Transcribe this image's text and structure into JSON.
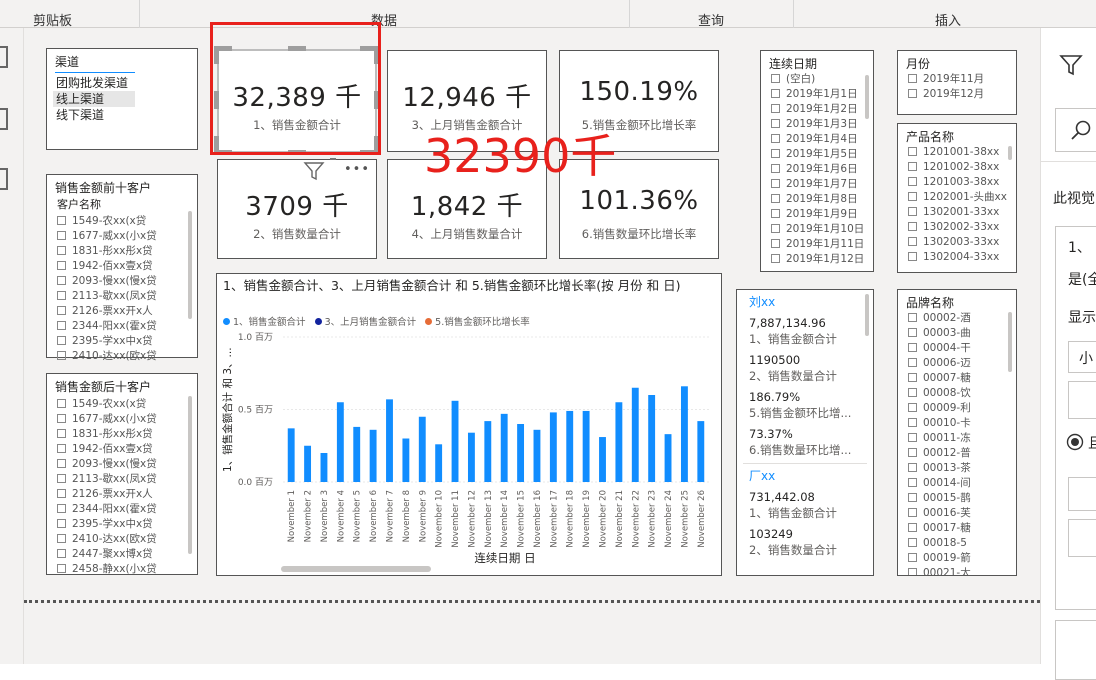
{
  "ribbon": {
    "groups": [
      "剪贴板",
      "数据",
      "查询",
      "插入"
    ]
  },
  "channel_slicer": {
    "title": "渠道",
    "items": [
      "团购批发渠道",
      "线上渠道",
      "线下渠道"
    ]
  },
  "cards": [
    {
      "value": "32,389 千",
      "label": "1、销售金额合计"
    },
    {
      "value": "12,946 千",
      "label": "3、上月销售金额合计"
    },
    {
      "value": "150.19%",
      "label": "5.销售金额环比增长率"
    },
    {
      "value": "3709 千",
      "label": "2、销售数量合计"
    },
    {
      "value": "1,842 千",
      "label": "4、上月销售数量合计"
    },
    {
      "value": "101.36%",
      "label": "6.销售数量环比增长率"
    }
  ],
  "annotation": "32390千",
  "top10": {
    "title": "销售金额前十客户",
    "header": "客户名称",
    "items": [
      "1549-农xx(x贷",
      "1677-威xx(小x贷",
      "1831-彤xx彤x贷",
      "1942-佰xx壹x贷",
      "2093-慢xx(慢x贷",
      "2113-歇xx(凤x贷",
      "2126-票xx开x人",
      "2344-阳xx(霍x贷",
      "2395-学xx中x贷",
      "2410-达xx(欧x贷"
    ]
  },
  "bottom10": {
    "title": "销售金额后十客户",
    "items": [
      "1549-农xx(x贷",
      "1677-威xx(小x贷",
      "1831-彤xx彤x贷",
      "1942-佰xx壹x贷",
      "2093-慢xx(慢x贷",
      "2113-歇xx(凤x贷",
      "2126-票xx开x人",
      "2344-阳xx(霍x贷",
      "2395-学xx中x贷",
      "2410-达xx(欧x贷",
      "2447-聚xx博x贷",
      "2458-静xx(小x贷"
    ]
  },
  "date_slicer": {
    "title": "连续日期",
    "items": [
      "(空白)",
      "2019年1月1日",
      "2019年1月2日",
      "2019年1月3日",
      "2019年1月4日",
      "2019年1月5日",
      "2019年1月6日",
      "2019年1月7日",
      "2019年1月8日",
      "2019年1月9日",
      "2019年1月10日",
      "2019年1月11日",
      "2019年1月12日"
    ]
  },
  "month_slicer": {
    "title": "月份",
    "items": [
      "2019年11月",
      "2019年12月"
    ]
  },
  "product_slicer": {
    "title": "产品名称",
    "items": [
      "1201001-38xx",
      "1201002-38xx",
      "1201003-38xx",
      "1202001-头曲xx",
      "1302001-33xx",
      "1302002-33xx",
      "1302003-33xx",
      "1302004-33xx"
    ]
  },
  "brand_slicer": {
    "title": "品牌名称",
    "items": [
      "00002-酒",
      "00003-曲",
      "00004-干",
      "00006-迈",
      "00007-糖",
      "00008-饮",
      "00009-利",
      "00010-卡",
      "00011-冻",
      "00012-普",
      "00013-茶",
      "00014-间",
      "00015-鹊",
      "00016-芙",
      "00017-糖",
      "00018-5",
      "00019-箭",
      "00021-太"
    ]
  },
  "multirow": [
    {
      "name": "刘xx",
      "rows": [
        {
          "v": "7,887,134.96",
          "k": "1、销售金额合计"
        },
        {
          "v": "1190500",
          "k": "2、销售数量合计"
        },
        {
          "v": "186.79%",
          "k": "5.销售金额环比增..."
        },
        {
          "v": "73.37%",
          "k": "6.销售数量环比增..."
        }
      ]
    },
    {
      "name": "厂xx",
      "rows": [
        {
          "v": "731,442.08",
          "k": "1、销售金额合计"
        },
        {
          "v": "103249",
          "k": "2、销售数量合计"
        }
      ]
    }
  ],
  "colors": {
    "series1": "#118dff",
    "series2": "#12239e",
    "series3": "#e66c37",
    "annotation": "#e8211c"
  },
  "chart_data": {
    "type": "bar",
    "title": "1、销售金额合计、3、上月销售金额合计 和 5.销售金额环比增长率(按 月份 和 日)",
    "xlabel": "连续日期 日",
    "ylabel": "1、销售金额合计 和 3、...",
    "legend": [
      "1、销售金额合计",
      "3、上月销售金额合计",
      "5.销售金额环比增长率"
    ],
    "ylim": [
      0,
      1.0
    ],
    "yticks": [
      "0.0 百万",
      "0.5 百万",
      "1.0 百万"
    ],
    "categories": [
      "November 1",
      "November 2",
      "November 3",
      "November 4",
      "November 5",
      "November 6",
      "November 7",
      "November 8",
      "November 9",
      "November 10",
      "November 11",
      "November 12",
      "November 13",
      "November 14",
      "November 15",
      "November 16",
      "November 17",
      "November 18",
      "November 19",
      "November 20",
      "November 21",
      "November 22",
      "November 23",
      "November 24",
      "November 25",
      "November 26"
    ],
    "values": [
      0.37,
      0.25,
      0.2,
      0.55,
      0.38,
      0.36,
      0.57,
      0.3,
      0.45,
      0.26,
      0.56,
      0.34,
      0.42,
      0.47,
      0.4,
      0.36,
      0.48,
      0.49,
      0.49,
      0.31,
      0.55,
      0.65,
      0.6,
      0.33,
      0.66,
      0.42
    ]
  },
  "right_pane": {
    "texts": [
      "此视觉",
      "1、",
      "是(全",
      "显示"
    ]
  }
}
